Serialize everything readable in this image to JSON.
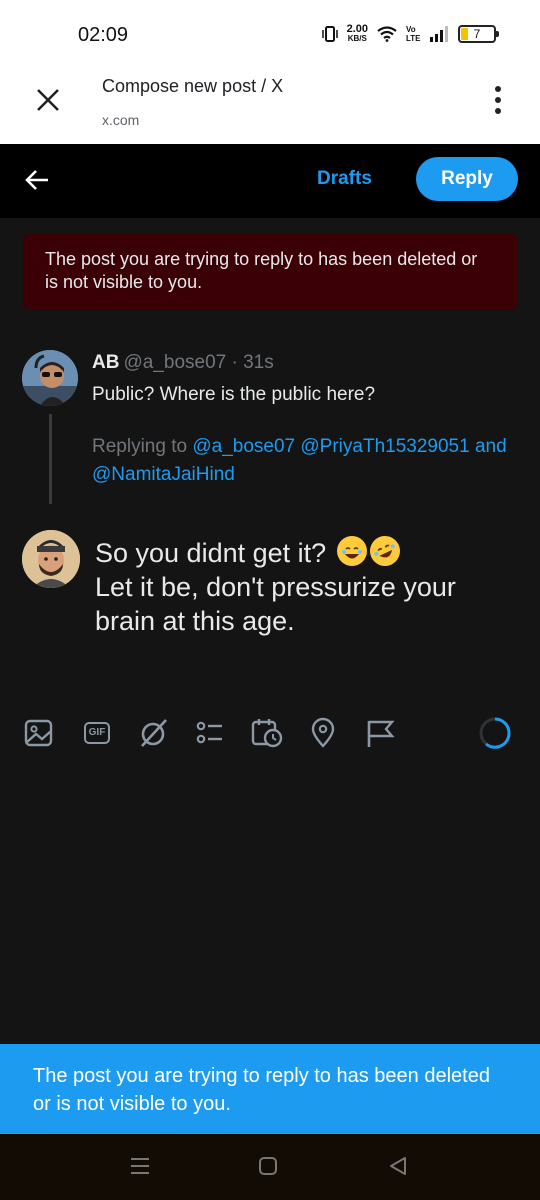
{
  "status_bar": {
    "time": "02:09",
    "net_speed_value": "2.00",
    "net_speed_unit": "KB/S",
    "volte": "Vo LTE",
    "battery": "7"
  },
  "browser_tab": {
    "title": "Compose new post / X",
    "url": "x.com"
  },
  "header": {
    "drafts_label": "Drafts",
    "reply_label": "Reply"
  },
  "error_banner": {
    "text": "The post you are trying to reply to has been deleted or is not visible to you."
  },
  "original_post": {
    "name": "AB",
    "handle": "@a_bose07",
    "time": "· 31s",
    "text": "Public? Where is the public here?",
    "replying_prefix": "Replying to",
    "mention_1": "@a_bose07",
    "mention_2": "@PriyaTh15329051",
    "and_word": "and",
    "mention_3": "@NamitaJaiHind"
  },
  "compose": {
    "line1": "So you didnt get it?",
    "line2": "Let it be, don't pressurize your brain at this age.",
    "gif_label": "GIF"
  },
  "toast": {
    "text": "The post you are trying to reply to has been deleted or is not visible to you."
  },
  "colors": {
    "accent": "#1d9bf0",
    "error_bg": "#3b0006",
    "background": "#141414"
  }
}
